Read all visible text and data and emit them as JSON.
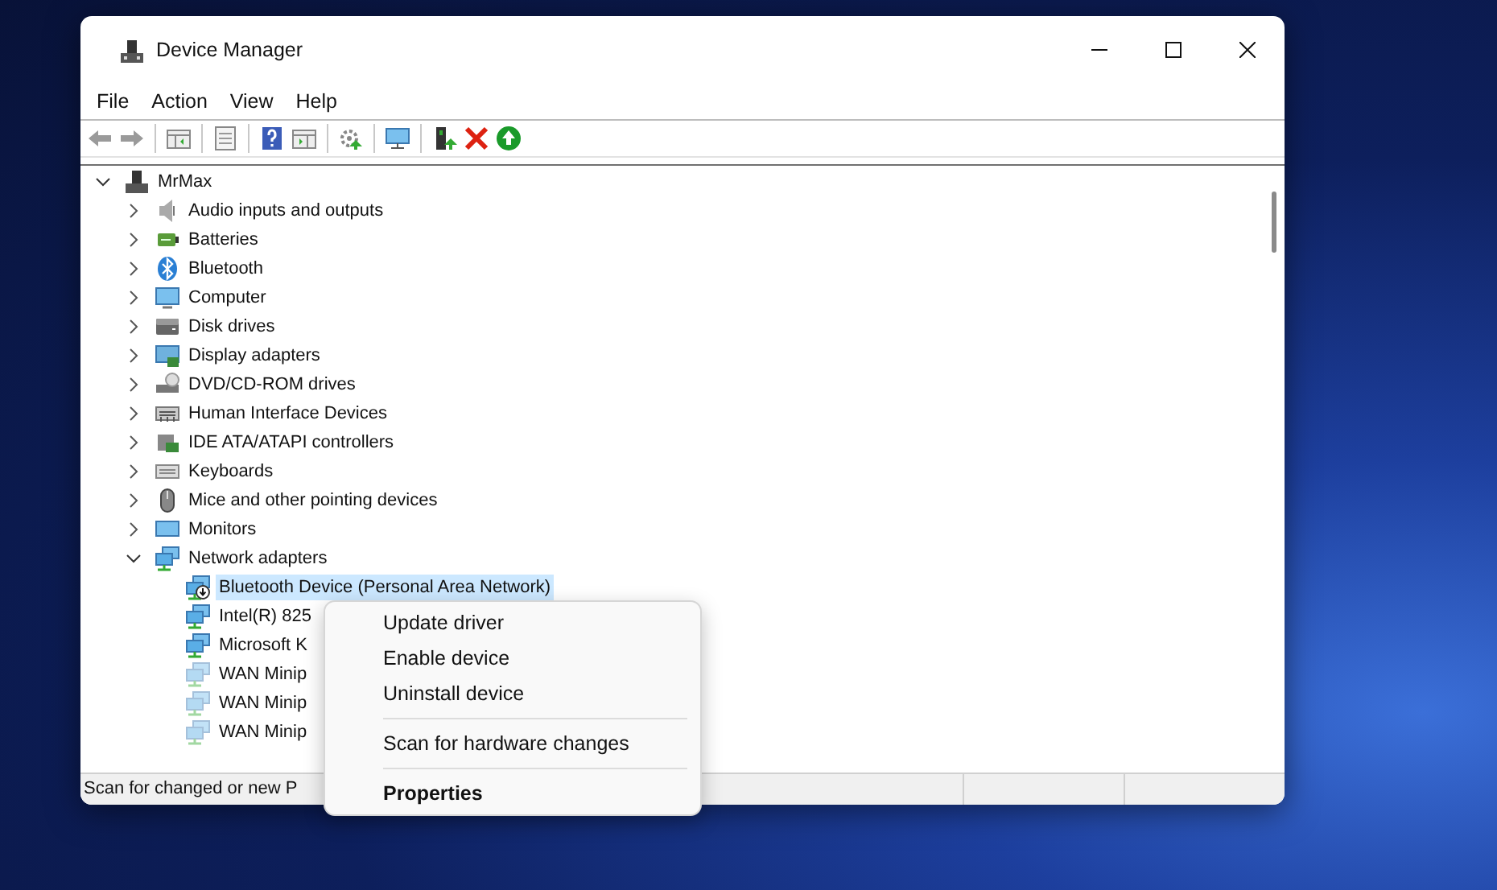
{
  "window": {
    "title": "Device Manager"
  },
  "menu_bar": [
    "File",
    "Action",
    "View",
    "Help"
  ],
  "tree": {
    "label": "MrMax",
    "expanded": true,
    "selected": false,
    "children": [
      {
        "label": "Audio inputs and outputs",
        "expanded": false,
        "selected": false
      },
      {
        "label": "Batteries",
        "expanded": false,
        "selected": false
      },
      {
        "label": "Bluetooth",
        "expanded": false,
        "selected": false
      },
      {
        "label": "Computer",
        "expanded": false,
        "selected": false
      },
      {
        "label": "Disk drives",
        "expanded": false,
        "selected": false
      },
      {
        "label": "Display adapters",
        "expanded": false,
        "selected": false
      },
      {
        "label": "DVD/CD-ROM drives",
        "expanded": false,
        "selected": false
      },
      {
        "label": "Human Interface Devices",
        "expanded": false,
        "selected": false
      },
      {
        "label": "IDE ATA/ATAPI controllers",
        "expanded": false,
        "selected": false
      },
      {
        "label": "Keyboards",
        "expanded": false,
        "selected": false
      },
      {
        "label": "Mice and other pointing devices",
        "expanded": false,
        "selected": false
      },
      {
        "label": "Monitors",
        "expanded": false,
        "selected": false
      },
      {
        "label": "Network adapters",
        "expanded": true,
        "selected": false,
        "children": [
          {
            "label": "Bluetooth Device (Personal Area Network)",
            "selected": true,
            "disabled": true,
            "hidden": false
          },
          {
            "label": "Intel(R) 825",
            "selected": false,
            "disabled": false,
            "hidden": false
          },
          {
            "label": "Microsoft K",
            "selected": false,
            "disabled": false,
            "hidden": false
          },
          {
            "label": "WAN Minip",
            "selected": false,
            "disabled": false,
            "hidden": true
          },
          {
            "label": "WAN Minip",
            "selected": false,
            "disabled": false,
            "hidden": true
          },
          {
            "label": "WAN Minip",
            "selected": false,
            "disabled": false,
            "hidden": true
          }
        ]
      }
    ]
  },
  "status_bar": {
    "text": "Scan for changed or new P"
  },
  "context_menu": [
    {
      "kind": "item",
      "label": "Update driver"
    },
    {
      "kind": "item",
      "label": "Enable device"
    },
    {
      "kind": "item",
      "label": "Uninstall device"
    },
    {
      "kind": "separator"
    },
    {
      "kind": "item",
      "label": "Scan for hardware changes"
    },
    {
      "kind": "separator"
    },
    {
      "kind": "default",
      "label": "Properties"
    }
  ]
}
